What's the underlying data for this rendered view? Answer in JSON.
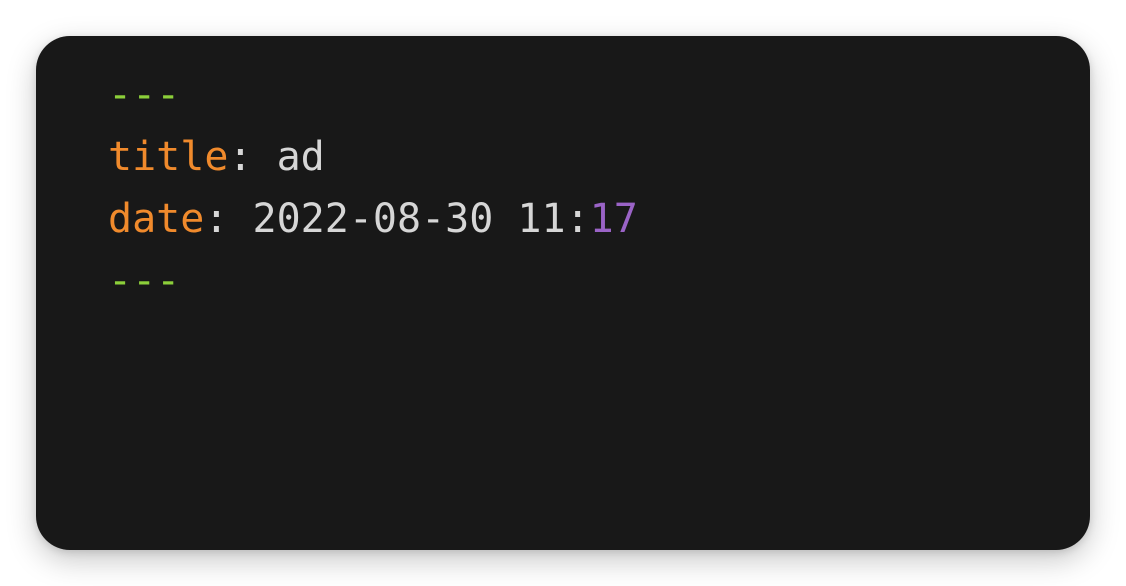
{
  "editor": {
    "lines": {
      "fence_open": "---",
      "title": {
        "key": "title",
        "colon": ":",
        "value": " ad"
      },
      "date": {
        "key": "date",
        "colon": ":",
        "value": " 2022-08-30 11:",
        "minutes": "17"
      },
      "fence_close": "---"
    }
  },
  "colors": {
    "background": "#181818",
    "fence": "#8ccf3a",
    "key": "#f08a2c",
    "text": "#d6d6d6",
    "number": "#9a63c6"
  }
}
